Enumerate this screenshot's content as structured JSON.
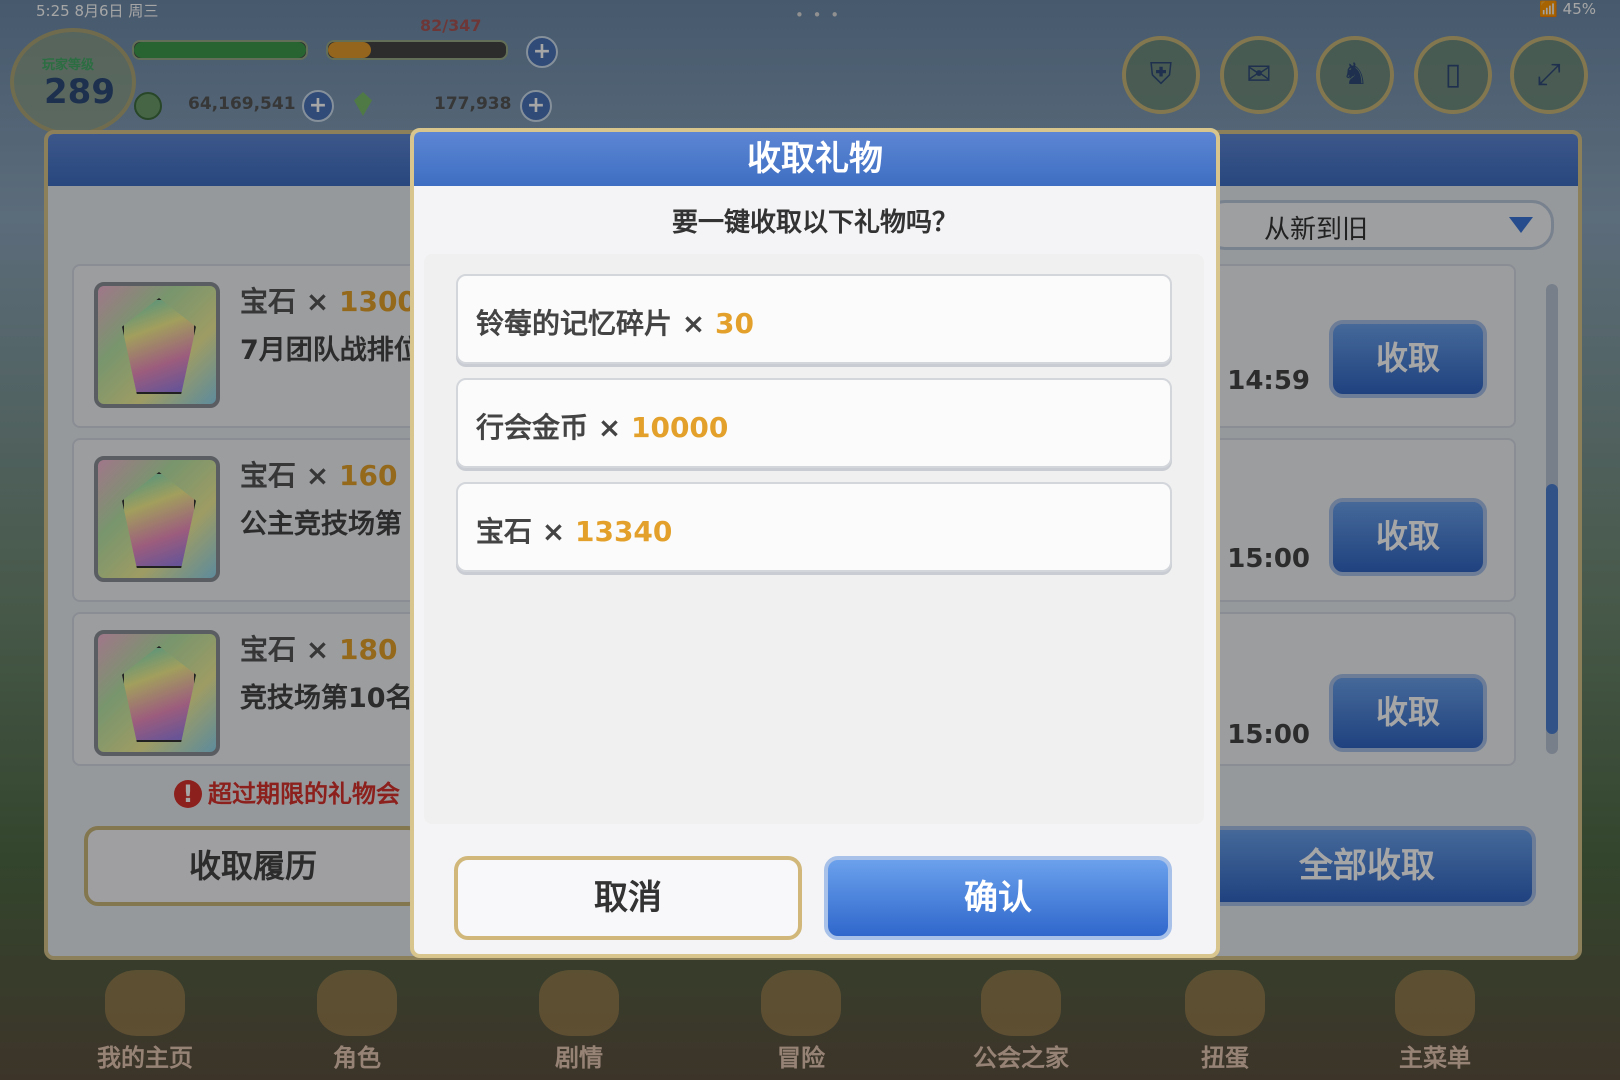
{
  "status_bar": {
    "time": "5:25",
    "date": "8月6日 周三",
    "battery": "45%"
  },
  "hud": {
    "level_label": "玩家等级",
    "level": "289",
    "stamina": "82/347",
    "mana": "64,169,541",
    "jewels": "177,938"
  },
  "sort": {
    "selected": "从新到旧"
  },
  "gifts": [
    {
      "name": "宝石",
      "amount": "13000",
      "desc": "7月团队战排位",
      "time": "21 14:59",
      "button": "收取"
    },
    {
      "name": "宝石",
      "amount": "160",
      "desc": "公主竞技场第",
      "time": "20 15:00",
      "button": "收取"
    },
    {
      "name": "宝石",
      "amount": "180",
      "desc": "竞技场第10名",
      "time": "20 15:00",
      "button": "收取"
    }
  ],
  "multiply": "×",
  "warning": "超过期限的礼物会",
  "history_button": "收取履历",
  "collect_all_button": "全部收取",
  "nav": [
    "我的主页",
    "角色",
    "剧情",
    "冒险",
    "公会之家",
    "扭蛋",
    "主菜单"
  ],
  "dialog": {
    "title": "收取礼物",
    "question": "要一键收取以下礼物吗？",
    "items": [
      {
        "name": "铃莓的记忆碎片",
        "amount": "30"
      },
      {
        "name": "行会金币",
        "amount": "10000"
      },
      {
        "name": "宝石",
        "amount": "13340"
      }
    ],
    "cancel": "取消",
    "confirm": "确认"
  }
}
